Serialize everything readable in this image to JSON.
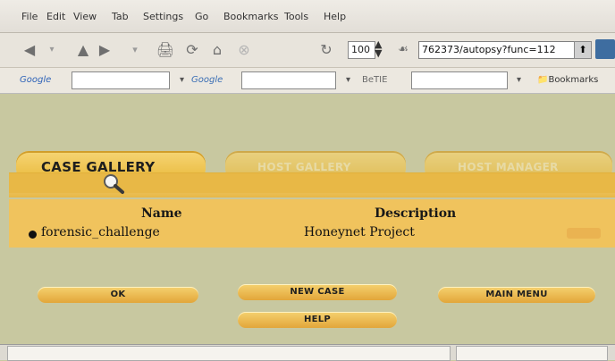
{
  "menu": [
    "File",
    "Edit",
    "View",
    "Tab",
    "Settings",
    "Go",
    "Bookmarks",
    "Tools",
    "Help"
  ],
  "toolbar": {
    "zoom": "100",
    "url": "762373/autopsy?func=112"
  },
  "search": {
    "google_label": "Google",
    "google2_label": "Google",
    "third_label": "BeTIE",
    "bookmarks_label": "Bookmarks"
  },
  "tabs": {
    "active": "CASE GALLERY",
    "faded1": "HOST GALLERY",
    "faded2": "HOST MANAGER"
  },
  "table": {
    "headers": [
      "Name",
      "Description"
    ],
    "rows": [
      {
        "name": "forensic_challenge",
        "description": "Honeynet Project"
      }
    ]
  },
  "buttons": {
    "ok": "OK",
    "new_case": "NEW CASE",
    "main_menu": "MAIN MENU",
    "help": "HELP"
  }
}
